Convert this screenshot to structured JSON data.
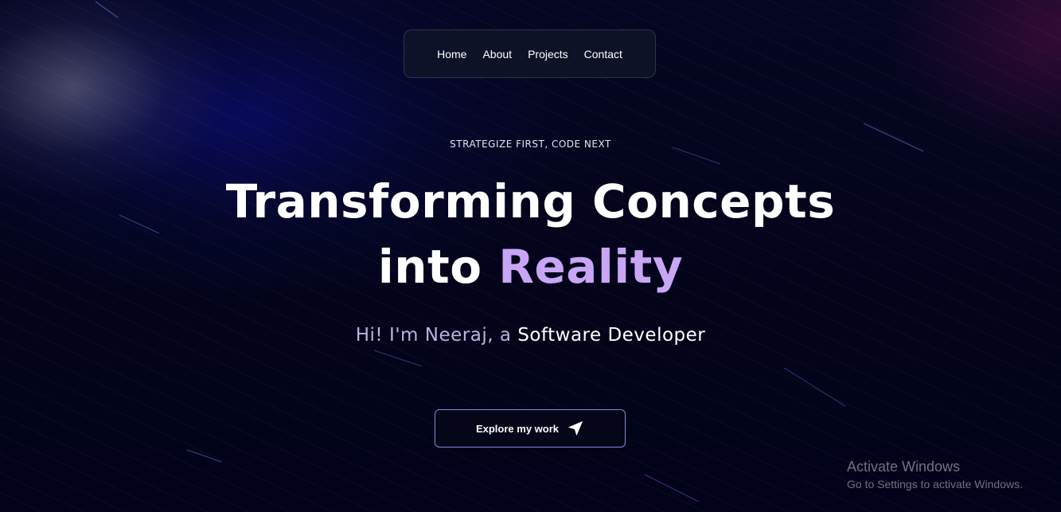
{
  "nav": {
    "items": [
      {
        "label": "Home"
      },
      {
        "label": "About"
      },
      {
        "label": "Projects"
      },
      {
        "label": "Contact"
      }
    ]
  },
  "hero": {
    "eyebrow": "STRATEGIZE FIRST, CODE NEXT",
    "headline_line1": "Transforming Concepts",
    "headline_line2_plain": "into ",
    "headline_line2_accent": "Reality",
    "intro_prefix": "Hi! I'm Neeraj, a ",
    "intro_role": "Software Developer",
    "cta_label": "Explore my work",
    "cta_icon": "send-icon"
  },
  "watermark": {
    "title": "Activate Windows",
    "subtitle": "Go to Settings to activate Windows."
  },
  "colors": {
    "background": "#03041a",
    "accent": "#c9a6f5",
    "cta_border": "#8a86e0"
  }
}
